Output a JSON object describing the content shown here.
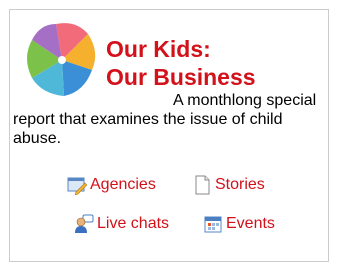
{
  "widget": {
    "title_line1": "Our Kids:",
    "title_line2": "Our Business",
    "description": "A monthlong special report that examines the issue of child abuse.",
    "logo_icon": "pinwheel-icon",
    "links": [
      {
        "label": "Agencies",
        "icon": "agencies-icon"
      },
      {
        "label": "Stories",
        "icon": "document-icon"
      },
      {
        "label": "Live chats",
        "icon": "chat-users-icon"
      },
      {
        "label": "Events",
        "icon": "calendar-icon"
      }
    ],
    "colors": {
      "accent": "#d2111a",
      "border": "#cccccc"
    }
  }
}
